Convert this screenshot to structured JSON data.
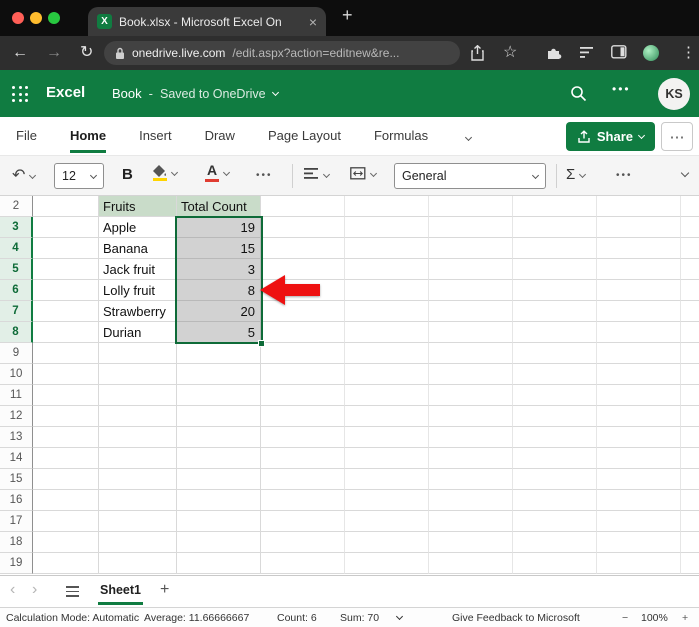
{
  "colors": {
    "excel_green": "#107c41",
    "header_cell_fill": "#c9dcc9",
    "selection_fill": "#d2d2d2",
    "arrow_red": "#ee1111"
  },
  "icons": {
    "close": "×",
    "back": "←",
    "forward": "→",
    "reload": "↻",
    "star": "☆",
    "menu_dots": "⋮",
    "new_tab": "+",
    "undo": "↶",
    "sigma": "Σ",
    "more_dots": "•••",
    "ellipsis": "⋯",
    "prev": "‹",
    "next": "›",
    "add_sheet": "+",
    "zoom_out": "−",
    "zoom_in": "+"
  },
  "browser": {
    "tab_title": "Book.xlsx - Microsoft Excel On",
    "favicon_letter": "X",
    "url_domain": "onedrive.live.com",
    "url_path": "/edit.aspx?action=editnew&re..."
  },
  "excel_header": {
    "app_name": "Excel",
    "doc_name": "Book",
    "separator": "-",
    "saved_status": "Saved to OneDrive",
    "avatar_initials": "KS"
  },
  "menubar": {
    "items": [
      "File",
      "Home",
      "Insert",
      "Draw",
      "Page Layout",
      "Formulas"
    ],
    "active_item": "Home",
    "share_label": "Share"
  },
  "ribbon": {
    "font_size": "12",
    "bold": "B",
    "font_color_letter": "A",
    "number_format": "General"
  },
  "grid": {
    "rows": [
      {
        "n": 2,
        "b": "Fruits",
        "c": "Total Count",
        "kind": "header"
      },
      {
        "n": 3,
        "b": "Apple",
        "c": "19",
        "kind": "selected"
      },
      {
        "n": 4,
        "b": "Banana",
        "c": "15",
        "kind": "selected"
      },
      {
        "n": 5,
        "b": "Jack fruit",
        "c": "3",
        "kind": "selected"
      },
      {
        "n": 6,
        "b": "Lolly fruit",
        "c": "8",
        "kind": "selected"
      },
      {
        "n": 7,
        "b": "Strawberry",
        "c": "20",
        "kind": "selected"
      },
      {
        "n": 8,
        "b": "Durian",
        "c": "5",
        "kind": "selected"
      },
      {
        "n": 9,
        "kind": "empty"
      },
      {
        "n": 10,
        "kind": "empty"
      },
      {
        "n": 11,
        "kind": "empty"
      },
      {
        "n": 12,
        "kind": "empty"
      },
      {
        "n": 13,
        "kind": "empty"
      },
      {
        "n": 14,
        "kind": "empty"
      },
      {
        "n": 15,
        "kind": "empty"
      },
      {
        "n": 16,
        "kind": "empty"
      },
      {
        "n": 17,
        "kind": "empty"
      },
      {
        "n": 18,
        "kind": "empty"
      },
      {
        "n": 19,
        "kind": "empty"
      }
    ]
  },
  "sheet_tabs": {
    "active": "Sheet1"
  },
  "status_bar": {
    "calc_mode": "Calculation Mode: Automatic",
    "average": "Average: 11.66666667",
    "count": "Count: 6",
    "sum": "Sum: 70",
    "feedback": "Give Feedback to Microsoft",
    "zoom": "100%"
  }
}
